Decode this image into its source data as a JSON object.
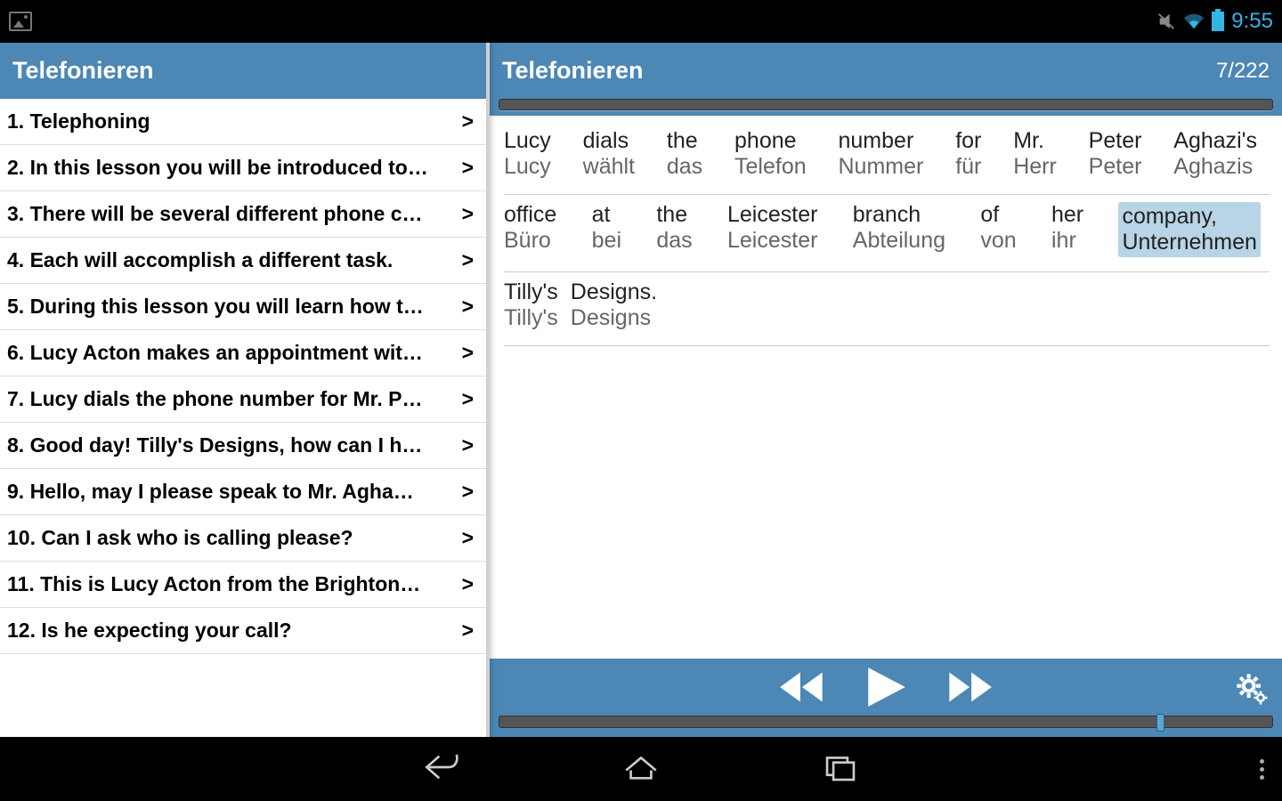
{
  "statusbar": {
    "time": "9:55"
  },
  "left": {
    "title": "Telefonieren",
    "items": [
      "1. Telephoning",
      "2. In this lesson you will be introduced to…",
      "3. There will be several different phone c…",
      "4. Each will accomplish a different task.",
      "5. During this lesson you will learn how t…",
      "6. Lucy Acton makes an appointment wit…",
      "7. Lucy dials the phone number for Mr. P…",
      "8. Good day! Tilly's Designs, how can I h…",
      "9. Hello, may I please speak to Mr. Agha…",
      "10. Can I ask who is calling please?",
      "11. This is Lucy Acton from the Brighton…",
      "12. Is he expecting your call?"
    ]
  },
  "right": {
    "title": "Telefonieren",
    "counter": "7/222",
    "lines": [
      {
        "justify": true,
        "words": [
          {
            "en": "Lucy",
            "de": "Lucy"
          },
          {
            "en": "dials",
            "de": "wählt"
          },
          {
            "en": "the",
            "de": "das"
          },
          {
            "en": "phone",
            "de": "Telefon"
          },
          {
            "en": "number",
            "de": "Nummer"
          },
          {
            "en": "for",
            "de": "für"
          },
          {
            "en": "Mr.",
            "de": "Herr"
          },
          {
            "en": "Peter",
            "de": "Peter"
          },
          {
            "en": "Aghazi's",
            "de": "Aghazis"
          }
        ]
      },
      {
        "justify": true,
        "sep": true,
        "words": [
          {
            "en": "office",
            "de": "Büro"
          },
          {
            "en": "at",
            "de": "bei"
          },
          {
            "en": "the",
            "de": "das"
          },
          {
            "en": "Leicester",
            "de": "Leicester"
          },
          {
            "en": "branch",
            "de": "Abteilung"
          },
          {
            "en": "of",
            "de": "von"
          },
          {
            "en": "her",
            "de": "ihr"
          },
          {
            "en": "company,",
            "de": "Unternehmen",
            "hl": true
          }
        ]
      },
      {
        "sep": true,
        "words": [
          {
            "en": "Tilly's",
            "de": "Tilly's"
          },
          {
            "en": "Designs.",
            "de": "Designs"
          }
        ]
      }
    ]
  }
}
